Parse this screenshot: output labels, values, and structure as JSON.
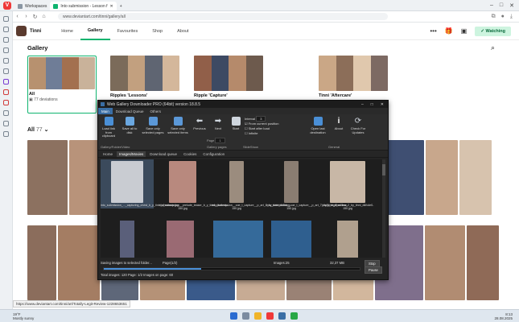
{
  "browser": {
    "tabs": [
      {
        "label": "Workspaces",
        "active": false
      },
      {
        "label": "Into submission - Lesson f",
        "active": true
      }
    ],
    "url": "www.deviantart.com/tinni/gallery/all"
  },
  "profile": {
    "name": "Tinni",
    "nav": [
      "Home",
      "Gallery",
      "Favourites",
      "Shop",
      "About"
    ],
    "selected": "Gallery",
    "watch_label": "Watching",
    "accent": "#0fb46f"
  },
  "gallery": {
    "title": "Gallery",
    "folders": [
      {
        "name": "All",
        "count": "77 deviations"
      },
      {
        "name": "Ripples 'Lessons'",
        "count": ""
      },
      {
        "name": "Ripple 'Capture'",
        "count": ""
      },
      {
        "name": "Tinni 'Aftercare'",
        "count": ""
      }
    ],
    "all_label": "All",
    "all_count": "77"
  },
  "downloader": {
    "title": "Web Gallery Downloader PRO (64bit) version 18.8.5",
    "tabs": [
      "Main",
      "Download Queue",
      "Others"
    ],
    "ribbon": [
      {
        "label": "Load link from clipboard",
        "color": "#4a8fd6"
      },
      {
        "label": "Save all to disk",
        "color": "#6aa7e0"
      },
      {
        "label": "Save only selected pages",
        "color": "#5b98d8"
      },
      {
        "label": "Save only selected items",
        "color": "#5b98d8"
      },
      {
        "label": "Previous",
        "color": "#cfd6de"
      },
      {
        "label": "Next",
        "color": "#cfd6de"
      },
      {
        "label": "Start",
        "color": "#cfd6de"
      },
      {
        "label": "Open last destination",
        "color": "#4a8fd6"
      },
      {
        "label": "About",
        "color": "#cfd6de"
      },
      {
        "label": "Check For Updates",
        "color": "#cfd6de"
      }
    ],
    "group_labels": [
      "Gallery/Folder/Video",
      "Gallery pages",
      "SlideShow",
      "General"
    ],
    "page_label": "Page",
    "page_value": "1",
    "interval_label": "Interval",
    "interval_value": "3",
    "options": [
      "From current position",
      "Start after load",
      "Infinite"
    ],
    "subtabs": [
      "Home",
      "Images/Movies",
      "Download queue",
      "Cookies",
      "Configuration"
    ],
    "thumbs": [
      "into_submission_..._capturing_chest_b_y_tinni_dhxmazp.jpg",
      "into_submission__prelude_teaser_b_y_tinni_dbekxzp-150.jpg",
      "into_submission__coe_t_capture__p_art_8_by_tinni_dbfhbrg-150.jpg",
      "into_submission__coe_t_capture__p_art_7_by_tinni_dba43ow-150.jpg",
      "totally_legit_review_2_by_tinni_dkfvde0-150.jpg"
    ],
    "status_text": "Saving images to selected folder...",
    "page_status": "Page(1/2)",
    "images_count": "Images:25",
    "size": "32,37 MB",
    "stop_label": "Stop",
    "pause_label": "Pause",
    "progress": 0.38,
    "totals": "Total images: 120   Page: 1/2   Images on page: 60"
  },
  "statusbar_url": "https://www.deviantart.com/tinni/art/Totally-Legit-Review-1228653651",
  "taskbar": {
    "temp": "19°F",
    "weather": "Mostly sunny",
    "time": "8:13",
    "date": "28.08.2025"
  }
}
